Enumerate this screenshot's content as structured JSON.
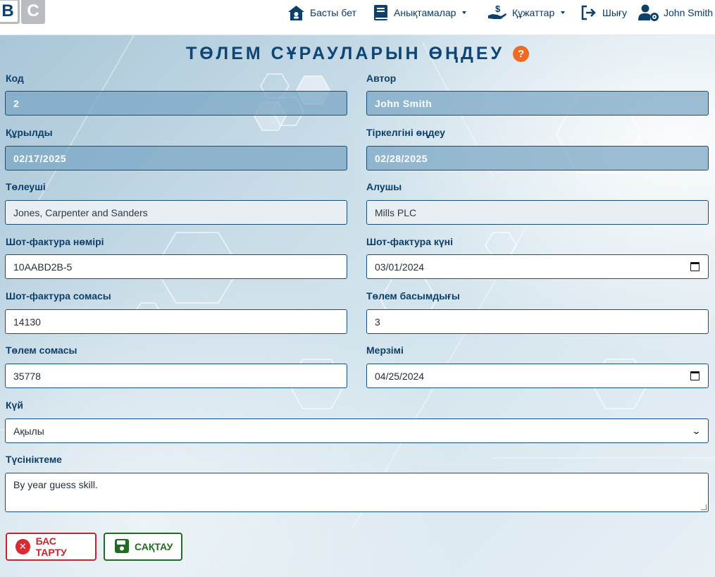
{
  "navbar": {
    "logo": [
      "B",
      "C"
    ],
    "items": [
      {
        "label": "Басты бет",
        "icon": "home-icon",
        "dropdown": false
      },
      {
        "label": "Анықтамалар",
        "icon": "book-icon",
        "dropdown": true
      },
      {
        "label": "Құжаттар",
        "icon": "hand-dollar-icon",
        "dropdown": true
      },
      {
        "label": "Шығу",
        "icon": "sign-out-icon",
        "dropdown": false
      },
      {
        "label": "John Smith",
        "icon": "user-gear-icon",
        "dropdown": false
      }
    ]
  },
  "page": {
    "title": "ТӨЛЕМ СҰРАУЛАРЫН ӨҢДЕУ",
    "help": "?"
  },
  "form": {
    "code": {
      "label": "Код",
      "value": "2"
    },
    "author": {
      "label": "Автор",
      "value": "John Smith"
    },
    "created": {
      "label": "Құрылды",
      "value": "02/17/2025"
    },
    "edited": {
      "label": "Тіркелгіні өңдеу",
      "value": "02/28/2025"
    },
    "payer": {
      "label": "Төлеуші",
      "value": "Jones, Carpenter and Sanders"
    },
    "receiver": {
      "label": "Алушы",
      "value": "Mills PLC"
    },
    "invoice_number": {
      "label": "Шот-фактура нөмірі",
      "value": "10AABD2B-5"
    },
    "invoice_date": {
      "label": "Шот-фактура күні",
      "value": "03/01/2024"
    },
    "invoice_amount": {
      "label": "Шот-фактура сомасы",
      "value": "14130"
    },
    "payment_priority": {
      "label": "Төлем басымдығы",
      "value": "3"
    },
    "payment_amount": {
      "label": "Төлем сомасы",
      "value": "35778"
    },
    "due_date": {
      "label": "Мерзімі",
      "value": "04/25/2024"
    },
    "status": {
      "label": "Күй",
      "value": "Ақылы"
    },
    "comment": {
      "label": "Түсініктеме",
      "value": "By year guess skill."
    }
  },
  "buttons": {
    "cancel": "БАС ТАРТУ",
    "save": "САҚТАУ"
  },
  "colors": {
    "accent": "#0d4577",
    "help": "#f06a23",
    "cancel": "#c6252d",
    "save": "#1f6b24",
    "locked_field": "#78a5c3"
  }
}
